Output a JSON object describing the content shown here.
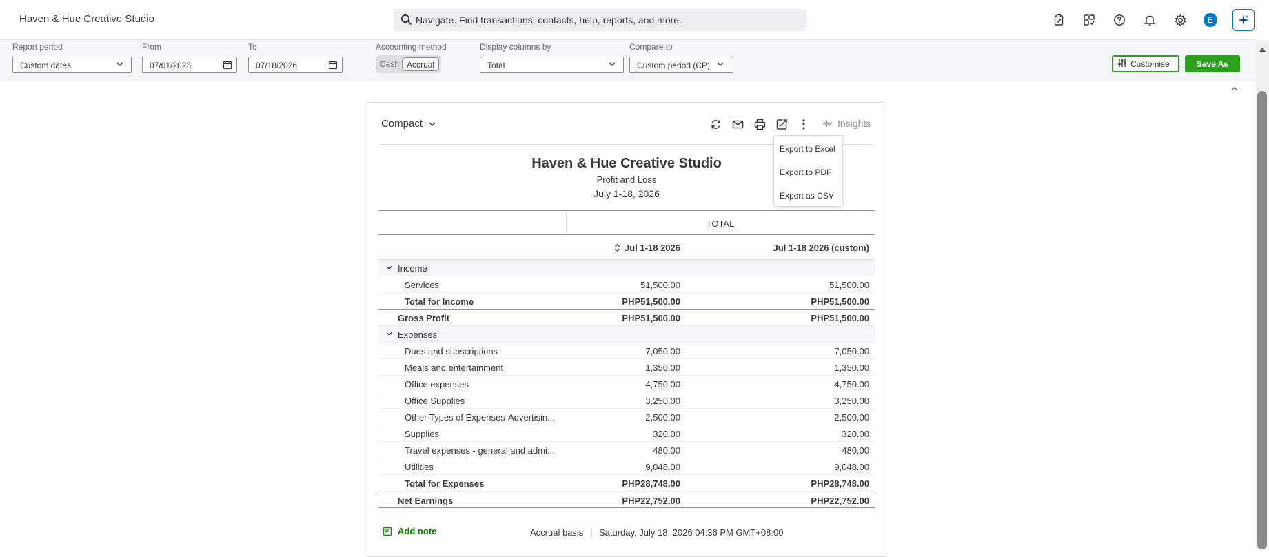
{
  "header": {
    "company": "Haven & Hue Creative Studio",
    "search_placeholder": "Navigate. Find transactions, contacts, help, reports, and more.",
    "avatar_initial": "E"
  },
  "filters": {
    "report_period_label": "Report period",
    "report_period_value": "Custom dates",
    "from_label": "From",
    "from_value": "07/01/2026",
    "to_label": "To",
    "to_value": "07/18/2026",
    "accounting_method_label": "Accounting method",
    "method_cash": "Cash",
    "method_accrual": "Accrual",
    "method_selected": "Accrual",
    "display_columns_label": "Display columns by",
    "display_columns_value": "Total",
    "compare_label": "Compare to",
    "compare_value": "Custom period (CP)",
    "customise_label": "Customise",
    "save_as_label": "Save As"
  },
  "report": {
    "view_mode": "Compact",
    "insights_label": "Insights",
    "company": "Haven & Hue Creative Studio",
    "name": "Profit and Loss",
    "period": "July 1-18, 2026",
    "total_header": "TOTAL",
    "col1": "Jul 1-18 2026",
    "col2": "Jul 1-18 2026 (custom)",
    "income": {
      "label": "Income",
      "rows": [
        {
          "label": "Services",
          "v1": "51,500.00",
          "v2": "51,500.00"
        }
      ],
      "total": {
        "label": "Total for Income",
        "v1": "PHP51,500.00",
        "v2": "PHP51,500.00"
      }
    },
    "gross_profit": {
      "label": "Gross Profit",
      "v1": "PHP51,500.00",
      "v2": "PHP51,500.00"
    },
    "expenses": {
      "label": "Expenses",
      "rows": [
        {
          "label": "Dues and subscriptions",
          "v1": "7,050.00",
          "v2": "7,050.00"
        },
        {
          "label": "Meals and entertainment",
          "v1": "1,350.00",
          "v2": "1,350.00"
        },
        {
          "label": "Office expenses",
          "v1": "4,750.00",
          "v2": "4,750.00"
        },
        {
          "label": "Office Supplies",
          "v1": "3,250.00",
          "v2": "3,250.00"
        },
        {
          "label": "Other Types of Expenses-Advertisin...",
          "v1": "2,500.00",
          "v2": "2,500.00"
        },
        {
          "label": "Supplies",
          "v1": "320.00",
          "v2": "320.00"
        },
        {
          "label": "Travel expenses - general and admi...",
          "v1": "480.00",
          "v2": "480.00"
        },
        {
          "label": "Utilities",
          "v1": "9,048.00",
          "v2": "9,048.00"
        }
      ],
      "total": {
        "label": "Total for Expenses",
        "v1": "PHP28,748.00",
        "v2": "PHP28,748.00"
      }
    },
    "net_earnings": {
      "label": "Net Earnings",
      "v1": "PHP22,752.00",
      "v2": "PHP22,752.00"
    },
    "add_note_label": "Add note",
    "basis": "Accrual basis",
    "generated": "Saturday, July 18, 2026 04:36 PM GMT+08:00"
  },
  "export_menu": {
    "items": [
      "Export to Excel",
      "Export to PDF",
      "Export as CSV"
    ]
  },
  "colors": {
    "accent_green": "#2ca01c",
    "link_green": "#108000",
    "brand_blue": "#0077c5"
  }
}
